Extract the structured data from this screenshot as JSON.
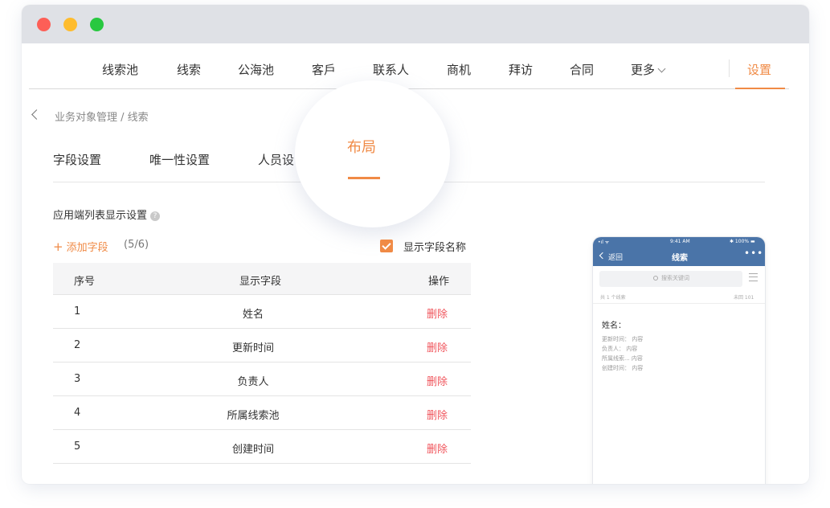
{
  "nav": {
    "items": [
      "线索池",
      "线索",
      "公海池",
      "客戶",
      "联系人",
      "商机",
      "拜访",
      "合同",
      "更多"
    ],
    "settings": "设置"
  },
  "breadcrumb": "业务对象管理 / 线索",
  "tabs": [
    "字段设置",
    "唯一性设置",
    "人员设",
    "布局"
  ],
  "active_tab": "布局",
  "section": {
    "title": "应用端列表显示设置",
    "help": "?"
  },
  "add_field": {
    "plus": "+",
    "label": "添加字段",
    "count": "(5/6)"
  },
  "show_names": {
    "label": "显示字段名称",
    "checked": true
  },
  "table": {
    "headers": [
      "序号",
      "显示字段",
      "操作"
    ],
    "rows": [
      {
        "index": "1",
        "field": "姓名",
        "action": "删除"
      },
      {
        "index": "2",
        "field": "更新时间",
        "action": "删除"
      },
      {
        "index": "3",
        "field": "负责人",
        "action": "删除"
      },
      {
        "index": "4",
        "field": "所属线索池",
        "action": "删除"
      },
      {
        "index": "5",
        "field": "创建时间",
        "action": "删除"
      }
    ]
  },
  "phone": {
    "status_left": "•ıl ᯤ",
    "time": "9:41 AM",
    "battery": "✱ 100% ▬",
    "back": "返回",
    "title": "线索",
    "more": "•••",
    "search_placeholder": "搜索关键词",
    "total_left": "共 1 个线索",
    "total_right": "未回 101",
    "card_title": "姓名：",
    "card_lines": [
      "更新时间：  内容",
      "负责人：     内容",
      "所属线索...  内容",
      "创建时间：  内容"
    ]
  },
  "colors": {
    "accent": "#f08a45",
    "danger": "#f0555c",
    "phone_header": "#4a74a8"
  }
}
